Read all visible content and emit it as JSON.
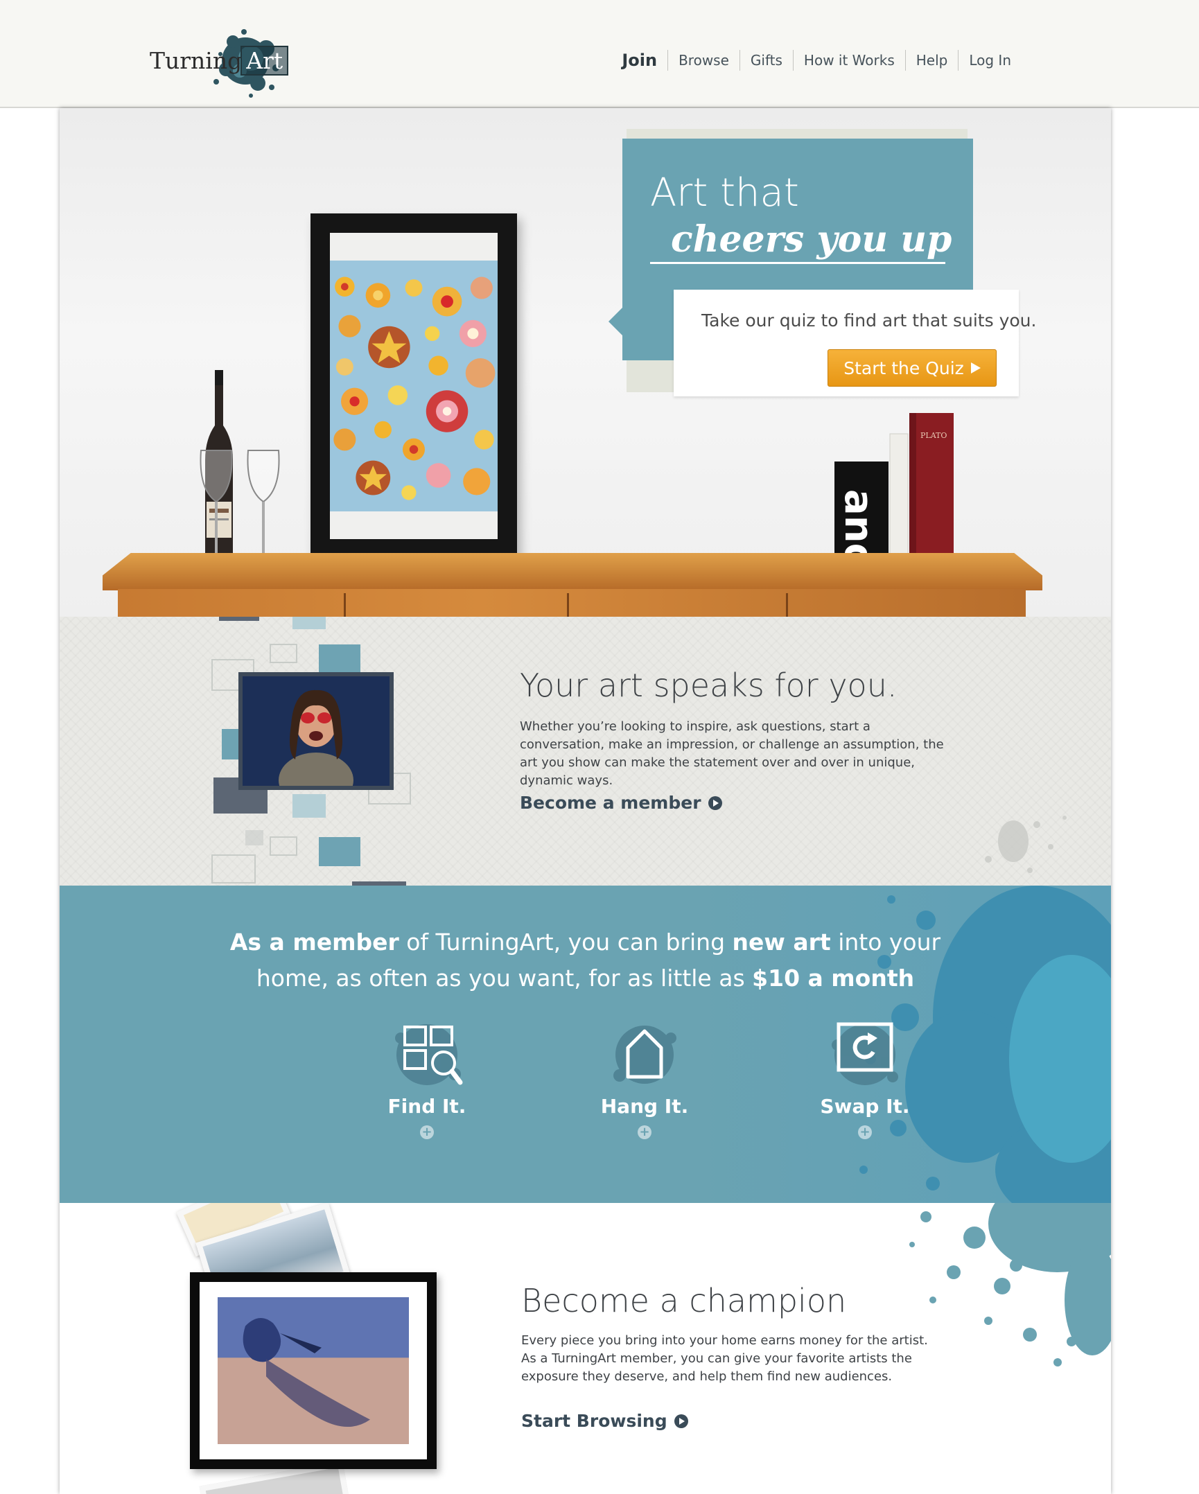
{
  "brand": {
    "name_left": "Turning",
    "name_right": "Art",
    "accent": "#6aa3b2",
    "button": "#f0a428"
  },
  "nav": {
    "join": "Join",
    "browse": "Browse",
    "gifts": "Gifts",
    "how": "How it Works",
    "help": "Help",
    "login": "Log In"
  },
  "hero": {
    "title": "Art that",
    "script": "cheers you up",
    "text": "Take our quiz to find art that suits you.",
    "cta": "Start the Quiz",
    "book_spine": "and",
    "book_title": "PLATO"
  },
  "speaks": {
    "title": "Your art speaks for you.",
    "body": "Whether you’re looking to inspire, ask questions, start a conversation, make an impression, or challenge an assumption, the art you show can make the statement over and over in unique, dynamic ways.",
    "link": "Become a member"
  },
  "band": {
    "h1_bold": "As a member",
    "h1_mid": " of TurningArt, you can bring ",
    "h1_bold2": "new art",
    "h1_end": " into your",
    "h2_start": "home, as often as you want, for as little as ",
    "h2_bold": "$10 a month",
    "features": [
      {
        "label": "Find It.",
        "icon": "find-icon"
      },
      {
        "label": "Hang It.",
        "icon": "hang-icon"
      },
      {
        "label": "Swap It.",
        "icon": "swap-icon"
      }
    ]
  },
  "champion": {
    "title": "Become a champion",
    "body": "Every piece you bring into your home earns money for the artist. As a TurningArt member, you can give your favorite artists the exposure they deserve, and help them find new audiences.",
    "link": "Start Browsing"
  }
}
